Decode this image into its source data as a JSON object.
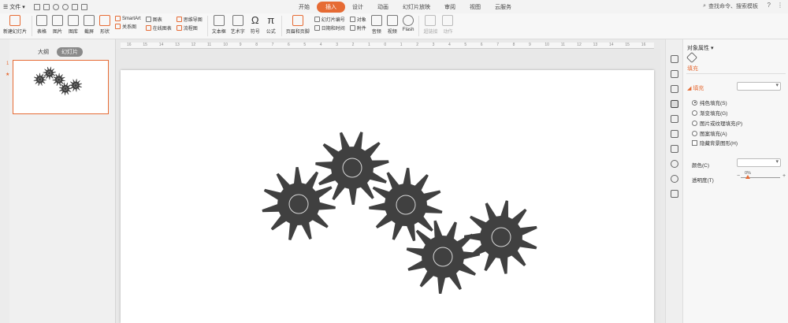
{
  "menubar": {
    "file_label": "文件",
    "tabs": [
      {
        "label": "开始",
        "active": false
      },
      {
        "label": "插入",
        "active": true
      },
      {
        "label": "设计",
        "active": false
      },
      {
        "label": "动画",
        "active": false
      },
      {
        "label": "幻灯片放映",
        "active": false
      },
      {
        "label": "审阅",
        "active": false
      },
      {
        "label": "视图",
        "active": false
      },
      {
        "label": "云服务",
        "active": false
      }
    ],
    "search_placeholder": "查找命令、搜索模板",
    "help_icon": "?"
  },
  "ribbon": {
    "new_slide": "新建幻灯片",
    "table": "表格",
    "picture": "图片",
    "gallery": "图库",
    "screenshot": "截屏",
    "shape": "形状",
    "smartart": "SmartArt",
    "relation": "关系图",
    "chart": "图表",
    "online_chart": "在线图表",
    "mindmap": "思维导图",
    "flowchart": "流程图",
    "textbox": "文本框",
    "wordart": "艺术字",
    "symbol": "符号",
    "formula": "公式",
    "header_footer": "页眉和页脚",
    "slide_number": "幻灯片编号",
    "datetime": "日期和时间",
    "object": "对象",
    "attachment": "附件",
    "audio": "音频",
    "video": "视频",
    "flash": "Flash",
    "hyperlink": "超链接",
    "action": "动作"
  },
  "ruler": {
    "labels": [
      "16",
      "15",
      "14",
      "13",
      "12",
      "11",
      "10",
      "9",
      "8",
      "7",
      "6",
      "5",
      "4",
      "3",
      "2",
      "1",
      "0",
      "1",
      "2",
      "3",
      "4",
      "5",
      "6",
      "7",
      "8",
      "9",
      "10",
      "11",
      "12",
      "13",
      "14",
      "15",
      "16"
    ]
  },
  "leftpane": {
    "tab_outline": "大纲",
    "tab_slides": "幻灯片",
    "slide_number": "1",
    "slide_star": "★"
  },
  "props": {
    "title": "对象属性",
    "fill_tab": "填充",
    "fill_section": "填充",
    "fill_options": [
      {
        "label": "纯色填充(S)",
        "selected": true
      },
      {
        "label": "渐变填充(G)",
        "selected": false
      },
      {
        "label": "图片或纹理填充(P)",
        "selected": false
      },
      {
        "label": "图案填充(A)",
        "selected": false
      }
    ],
    "hide_bg": "隐藏背景图形(H)",
    "color_label": "颜色(C)",
    "transparency_label": "透明度(T)",
    "transparency_value": "0%",
    "minus": "−",
    "plus": "+"
  },
  "colors": {
    "accent": "#e66b34",
    "gear": "#404040"
  }
}
